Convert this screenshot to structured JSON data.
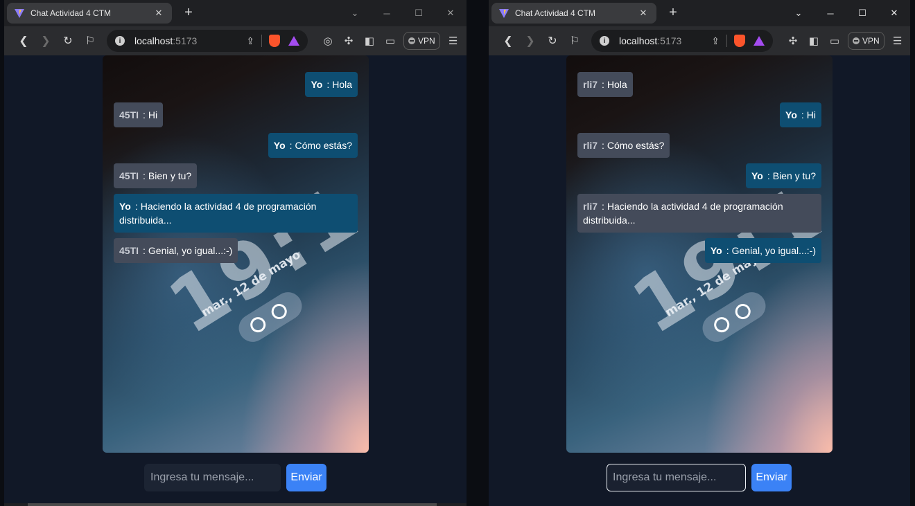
{
  "windows": [
    {
      "tab_title": "Chat Actividad 4 CTM",
      "url_host": "localhost",
      "url_port": ":5173",
      "vpn_label": "VPN",
      "input_placeholder": "Ingresa tu mensaje...",
      "send_label": "Enviar",
      "wallpaper": {
        "clock": "19:1",
        "date": "mar., 12 de mayo"
      },
      "messages": [
        {
          "user": "Yo",
          "text": "Hola",
          "mine": true
        },
        {
          "user": "45TI",
          "text": "Hi",
          "mine": false
        },
        {
          "user": "Yo",
          "text": "Cómo estás?",
          "mine": true
        },
        {
          "user": "45TI",
          "text": "Bien y tu?",
          "mine": false
        },
        {
          "user": "Yo",
          "text": "Haciendo la actividad 4 de programación distribuida...",
          "mine": true
        },
        {
          "user": "45TI",
          "text": "Genial, yo igual...:-)",
          "mine": false
        }
      ]
    },
    {
      "tab_title": "Chat Actividad 4 CTM",
      "url_host": "localhost",
      "url_port": ":5173",
      "vpn_label": "VPN",
      "input_placeholder": "Ingresa tu mensaje...",
      "send_label": "Enviar",
      "wallpaper": {
        "clock": "19:1",
        "date": "mar., 12 de mayo"
      },
      "messages": [
        {
          "user": "rli7",
          "text": "Hola",
          "mine": false
        },
        {
          "user": "Yo",
          "text": "Hi",
          "mine": true
        },
        {
          "user": "rli7",
          "text": "Cómo estás?",
          "mine": false
        },
        {
          "user": "Yo",
          "text": "Bien y tu?",
          "mine": true
        },
        {
          "user": "rli7",
          "text": "Haciendo la actividad 4 de programación distribuida...",
          "mine": false
        },
        {
          "user": "Yo",
          "text": "Genial, yo igual...:-)",
          "mine": true
        }
      ]
    }
  ],
  "colors": {
    "mine_bubble": "#0e4e72",
    "other_bubble": "#444b5a",
    "send_button": "#3b82f6",
    "page_bg": "#111827"
  },
  "icons": [
    "vite-favicon",
    "close-icon",
    "plus-icon",
    "back-icon",
    "forward-icon",
    "reload-icon",
    "bookmark-icon",
    "info-icon",
    "share-icon",
    "brave-shield-icon",
    "rewards-icon",
    "extensions-icon",
    "sidebar-icon",
    "wallet-icon",
    "menu-icon",
    "minimize-icon",
    "maximize-icon",
    "chat-icon"
  ]
}
